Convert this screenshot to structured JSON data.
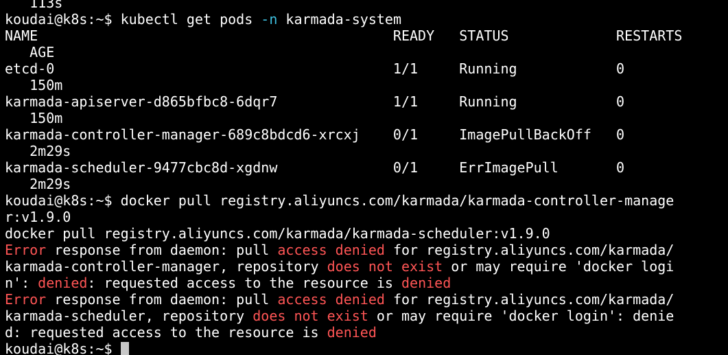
{
  "colors": {
    "background": "#000000",
    "foreground": "#ffffff",
    "flag": "#3ec0e0",
    "error": "#ff5555",
    "cursor": "#c8c8c8"
  },
  "terminal": {
    "lines": [
      {
        "segments": [
          {
            "text": "   113s",
            "style": "plain"
          }
        ]
      },
      {
        "segments": [
          {
            "text": "koudai@k8s:~$ kubectl get pods ",
            "style": "plain"
          },
          {
            "text": "-n",
            "style": "flag"
          },
          {
            "text": " karmada-system",
            "style": "plain"
          }
        ]
      },
      {
        "segments": [
          {
            "text": "NAME                                           READY   STATUS             RESTARTS",
            "style": "plain"
          }
        ]
      },
      {
        "segments": [
          {
            "text": "   AGE",
            "style": "plain"
          }
        ]
      },
      {
        "segments": [
          {
            "text": "etcd-0                                         1/1     Running            0",
            "style": "plain"
          }
        ]
      },
      {
        "segments": [
          {
            "text": "   150m",
            "style": "plain"
          }
        ]
      },
      {
        "segments": [
          {
            "text": "karmada-apiserver-d865bfbc8-6dqr7              1/1     Running            0",
            "style": "plain"
          }
        ]
      },
      {
        "segments": [
          {
            "text": "   150m",
            "style": "plain"
          }
        ]
      },
      {
        "segments": [
          {
            "text": "karmada-controller-manager-689c8bdcd6-xrcxj    0/1     ImagePullBackOff   0",
            "style": "plain"
          }
        ]
      },
      {
        "segments": [
          {
            "text": "   2m29s",
            "style": "plain"
          }
        ]
      },
      {
        "segments": [
          {
            "text": "karmada-scheduler-9477cbc8d-xgdnw              0/1     ErrImagePull       0",
            "style": "plain"
          }
        ]
      },
      {
        "segments": [
          {
            "text": "   2m29s",
            "style": "plain"
          }
        ]
      },
      {
        "segments": [
          {
            "text": "koudai@k8s:~$ docker pull registry.aliyuncs.com/karmada/karmada-controller-manage",
            "style": "plain"
          }
        ]
      },
      {
        "segments": [
          {
            "text": "r:v1.9.0",
            "style": "plain"
          }
        ]
      },
      {
        "segments": [
          {
            "text": "docker pull registry.aliyuncs.com/karmada/karmada-scheduler:v1.9.0",
            "style": "plain"
          }
        ]
      },
      {
        "segments": [
          {
            "text": "Error",
            "style": "error"
          },
          {
            "text": " response from daemon: pull ",
            "style": "plain"
          },
          {
            "text": "access denied",
            "style": "error"
          },
          {
            "text": " for registry.aliyuncs.com/karmada/",
            "style": "plain"
          }
        ]
      },
      {
        "segments": [
          {
            "text": "karmada-controller-manager, repository ",
            "style": "plain"
          },
          {
            "text": "does not exist",
            "style": "error"
          },
          {
            "text": " or may require 'docker logi",
            "style": "plain"
          }
        ]
      },
      {
        "segments": [
          {
            "text": "n': ",
            "style": "plain"
          },
          {
            "text": "denied",
            "style": "error"
          },
          {
            "text": ": requested access to the resource is ",
            "style": "plain"
          },
          {
            "text": "denied",
            "style": "error"
          }
        ]
      },
      {
        "segments": [
          {
            "text": "Error",
            "style": "error"
          },
          {
            "text": " response from daemon: pull ",
            "style": "plain"
          },
          {
            "text": "access denied",
            "style": "error"
          },
          {
            "text": " for registry.aliyuncs.com/karmada/",
            "style": "plain"
          }
        ]
      },
      {
        "segments": [
          {
            "text": "karmada-scheduler, repository ",
            "style": "plain"
          },
          {
            "text": "does not exist",
            "style": "error"
          },
          {
            "text": " or may require 'docker login': denie",
            "style": "plain"
          }
        ]
      },
      {
        "segments": [
          {
            "text": "d: requested access to the resource is ",
            "style": "plain"
          },
          {
            "text": "denied",
            "style": "error"
          }
        ]
      },
      {
        "segments": [
          {
            "text": "koudai@k8s:~$ ",
            "style": "plain"
          }
        ],
        "cursor": true
      }
    ]
  }
}
